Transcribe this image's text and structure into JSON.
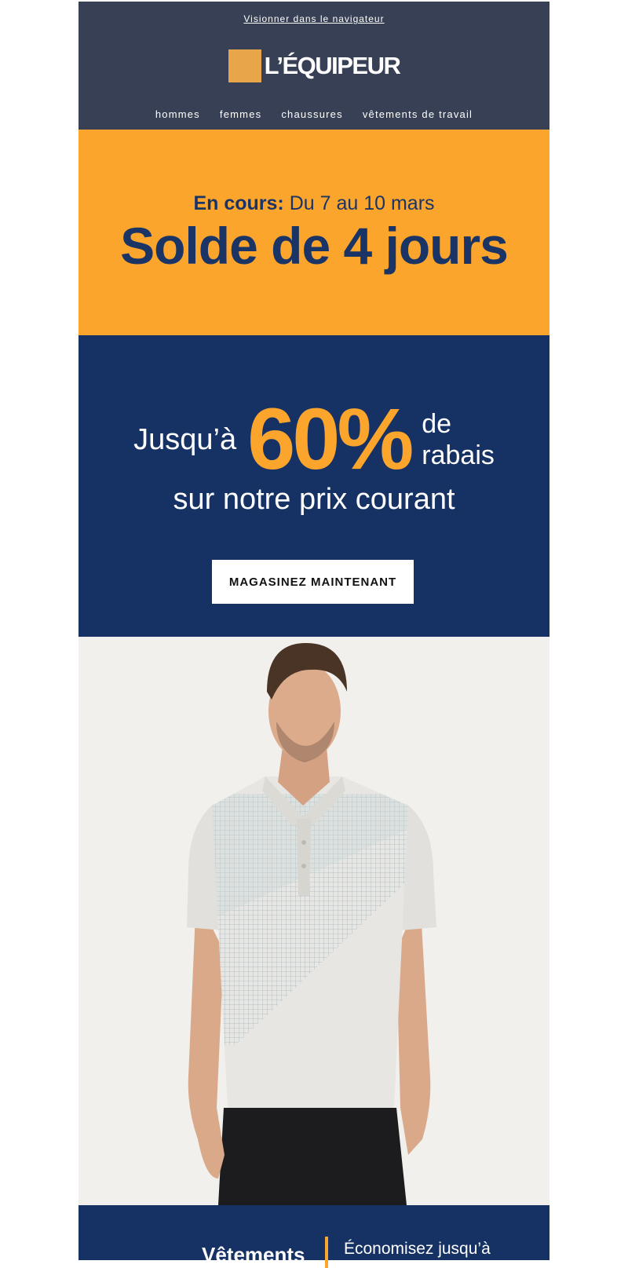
{
  "header": {
    "view_link": "Visionner dans le navigateur",
    "logo_text": "L’ÉQUIPEUR",
    "nav": [
      "hommes",
      "femmes",
      "chaussures",
      "vêtements de travail"
    ]
  },
  "sale": {
    "dates_bold": "En cours:",
    "dates": "Du 7 au 10 mars",
    "title": "Solde de 4 jours"
  },
  "promo": {
    "up_to": "Jusqu’à",
    "percent": "60%",
    "of": "de",
    "discount": "rabais",
    "subtitle": "sur notre prix courant",
    "cta": "MAGASINEZ MAINTENANT"
  },
  "bottom": {
    "left": "Vêtements",
    "right": "Économisez jusqu’à"
  },
  "colors": {
    "header_bg": "#374055",
    "accent_orange": "#fba52d",
    "navy": "#163265",
    "hero_bg": "#f1f0ed"
  }
}
